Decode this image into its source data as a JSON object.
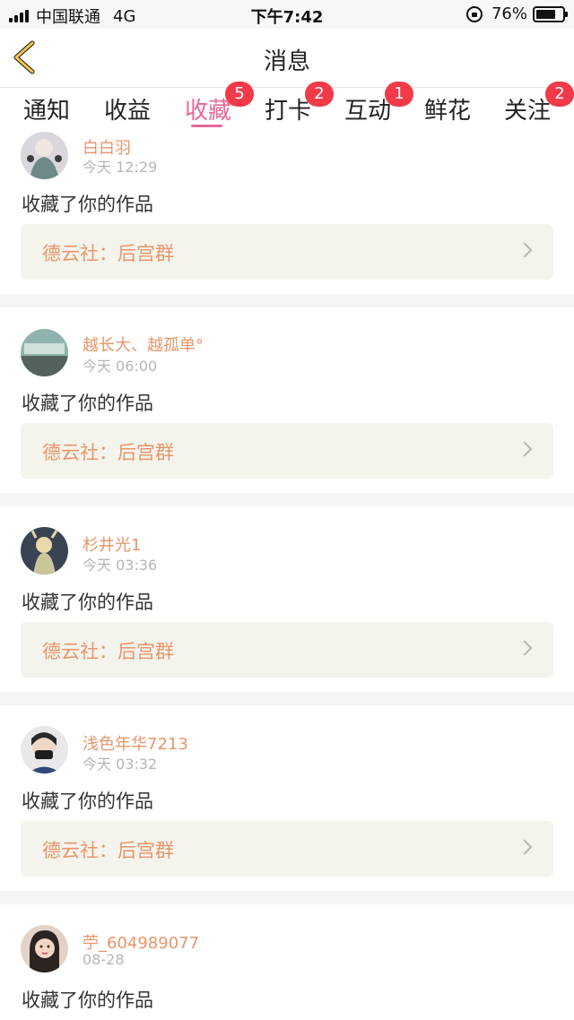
{
  "status_bar": {
    "carrier": "中国联通",
    "network": "4G",
    "time": "下午7:42",
    "battery": "76%",
    "battery_level": 0.76
  },
  "header": {
    "title": "消息",
    "back_icon": "chevron-left-icon",
    "accent_color": "#e8679a"
  },
  "tabs": [
    {
      "label": "通知",
      "badge": ""
    },
    {
      "label": "收益",
      "badge": ""
    },
    {
      "label": "收藏",
      "badge": "5",
      "active": true
    },
    {
      "label": "打卡",
      "badge": "2"
    },
    {
      "label": "互动",
      "badge": "1"
    },
    {
      "label": "鲜花",
      "badge": ""
    },
    {
      "label": "关注",
      "badge": "2"
    }
  ],
  "notifications": [
    {
      "username": "白白羽",
      "time": "今天 12:29",
      "action": "收藏了你的作品",
      "work": "德云社：后宫群"
    },
    {
      "username": "越长大、越孤单°",
      "time": "今天 06:00",
      "action": "收藏了你的作品",
      "work": "德云社：后宫群"
    },
    {
      "username": "杉井光1",
      "time": "今天 03:36",
      "action": "收藏了你的作品",
      "work": "德云社：后宫群"
    },
    {
      "username": "浅色年华7213",
      "time": "今天 03:32",
      "action": "收藏了你的作品",
      "work": "德云社：后宫群"
    },
    {
      "username": "苧_604989077",
      "time": "08-28",
      "action": "收藏了你的作品",
      "work": ""
    }
  ]
}
